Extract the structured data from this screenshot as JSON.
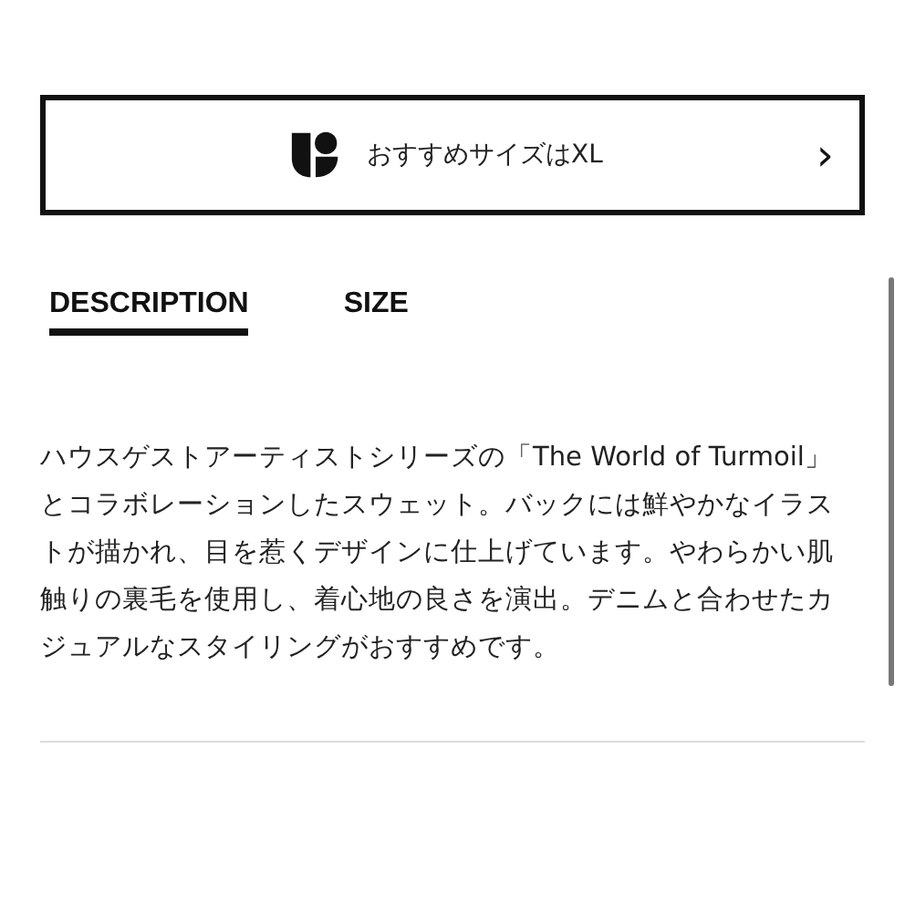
{
  "size_recommendation": {
    "label": "おすすめサイズはXL",
    "chevron": "›"
  },
  "tabs": [
    {
      "label": "DESCRIPTION",
      "selected": true
    },
    {
      "label": "SIZE",
      "selected": false
    }
  ],
  "description": "ハウスゲストアーティストシリーズの「The World of Turmoil」とコラボレーションしたスウェット。バックには鮮やかなイラストが描かれ、目を惹くデザインに仕上げています。やわらかい肌触りの裏毛を使用し、着心地の良さを演出。デニムと合わせたカジュアルなスタイリングがおすすめです。"
}
